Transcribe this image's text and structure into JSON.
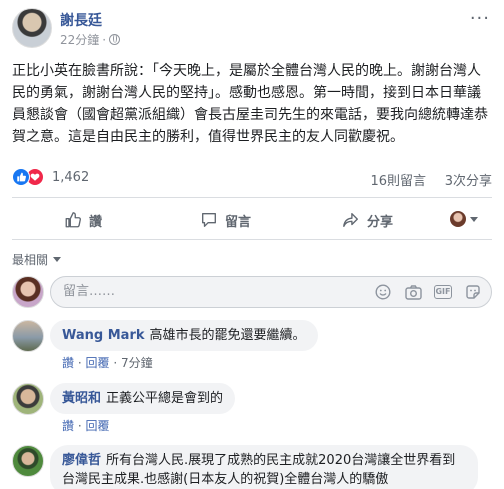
{
  "post": {
    "author": "謝長廷",
    "time": "22分鐘",
    "separator": "·",
    "more": "···",
    "body": "正比小英在臉書所說：「今天晚上，是屬於全體台灣人民的晚上。謝謝台灣人民的勇氣，謝謝台灣人民的堅持」。感動也感恩。第一時間，接到日本日華議員懇談會（國會超黨派組織）會長古屋圭司先生的來電話，要我向總統轉達恭賀之意。這是自由民主的勝利，值得世界民主的友人同歡慶祝。",
    "reaction_count": "1,462",
    "comment_count": "16則留言",
    "share_count": "3次分享"
  },
  "actions": {
    "like": "讚",
    "comment": "留言",
    "share": "分享"
  },
  "sort": {
    "label": "最相關"
  },
  "composer": {
    "placeholder": "留言……"
  },
  "comments": [
    {
      "name": "Wang Mark",
      "text": "高雄市長的罷免還要繼續。",
      "like": "讚",
      "reply": "回覆",
      "time": "7分鐘"
    },
    {
      "name": "黃昭和",
      "text": "正義公平總是會到的",
      "like": "讚",
      "reply": "回覆"
    },
    {
      "name": "廖偉哲",
      "text": "所有台灣人民.展現了成熟的民主成就2020台灣讓全世界看到台灣民主成果.也感謝(日本友人的祝賀)全體台灣人的驕傲"
    }
  ],
  "icons": {
    "like_badge": "thumbs-up-icon",
    "heart_badge": "heart-icon",
    "like_action": "thumbs-up-icon",
    "comment_action": "speech-bubble-icon",
    "share_action": "share-arrow-icon",
    "emoji": "smiley-icon",
    "camera": "camera-icon",
    "gif": "gif-icon",
    "sticker": "sticker-icon",
    "globe": "globe-icon"
  },
  "colors": {
    "link": "#385898",
    "meta": "#606770",
    "like": "#1877f2",
    "heart": "#f0284a",
    "bubble": "#f2f3f5"
  }
}
